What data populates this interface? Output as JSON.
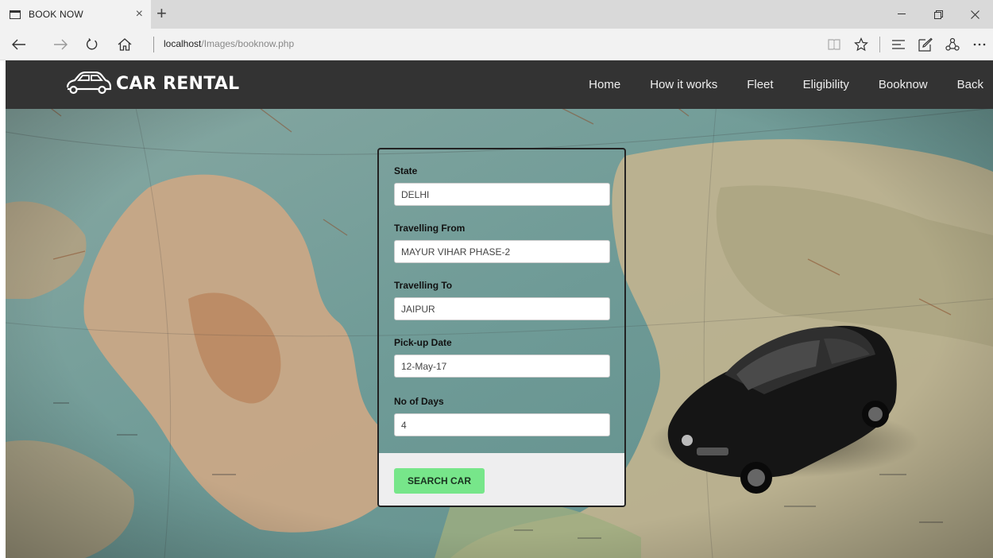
{
  "browser": {
    "tab_title": "BOOK NOW",
    "tab_close": "×",
    "new_tab": "+",
    "url_host": "localhost",
    "url_path": "/Images/booknow.php"
  },
  "site": {
    "logo_text": "CAR RENTAL",
    "nav": [
      {
        "label": "Home"
      },
      {
        "label": "How it works"
      },
      {
        "label": "Fleet"
      },
      {
        "label": "Eligibility"
      },
      {
        "label": "Booknow"
      },
      {
        "label": "Back"
      }
    ]
  },
  "form": {
    "fields": [
      {
        "label": "State",
        "value": "DELHI"
      },
      {
        "label": "Travelling From",
        "value": "MAYUR VIHAR PHASE-2"
      },
      {
        "label": "Travelling To",
        "value": "JAIPUR"
      },
      {
        "label": "Pick-up Date",
        "value": "12-May-17"
      },
      {
        "label": "No of Days",
        "value": "4"
      }
    ],
    "submit_label": "SEARCH CAR"
  },
  "colors": {
    "navbar": "#333333",
    "submit": "#77e68a",
    "map_sea": "#6f9b97",
    "map_land": "#c9a886"
  }
}
